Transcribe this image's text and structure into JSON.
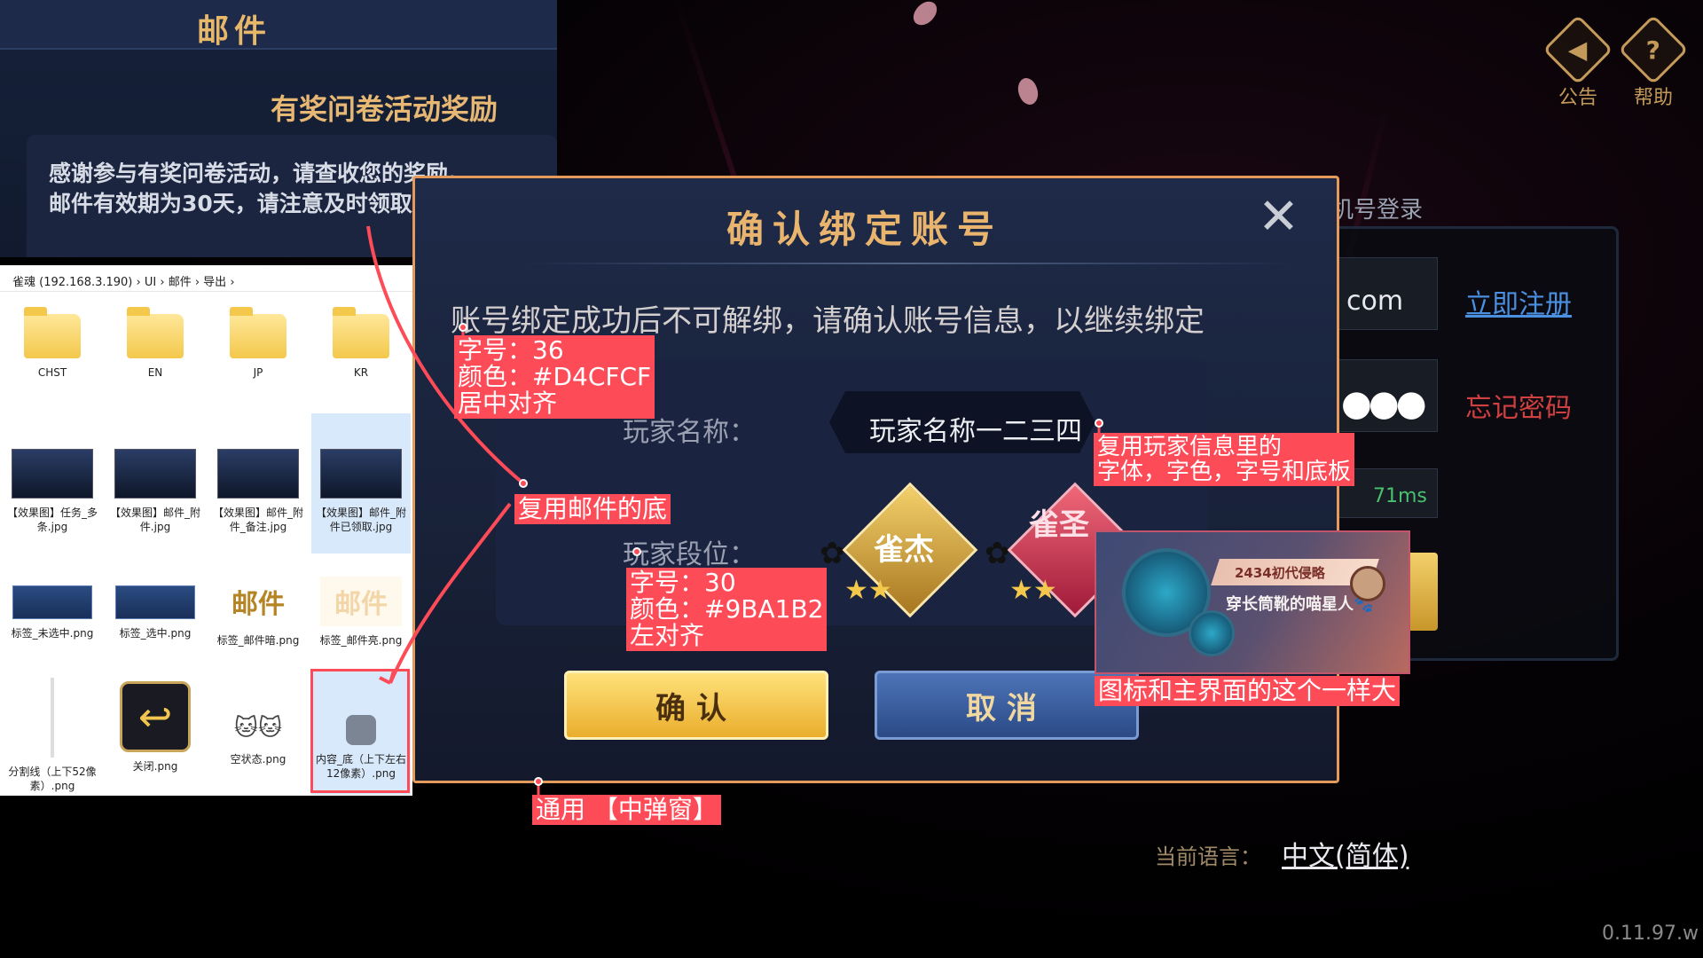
{
  "top_right": {
    "announcement_label": "公告",
    "help_label": "帮助"
  },
  "login": {
    "title_fragment": "机号登录",
    "email_fragment": "com",
    "password_dots": "●●●",
    "ping": "71ms",
    "register_link": "立即注册",
    "forgot_link": "忘记密码",
    "language_label": "当前语言：",
    "language_value": "中文(简体)"
  },
  "version": "0.11.97.w",
  "mail_panel": {
    "tab": "邮件",
    "subject": "有奖问卷活动奖励",
    "body_line1": "感谢参与有奖问卷活动，请查收您的奖励。",
    "body_line2": "邮件有效期为30天，请注意及时领取。"
  },
  "explorer": {
    "breadcrumb": [
      "雀魂 (192.168.3.190)",
      "UI",
      "邮件",
      "导出"
    ],
    "files": [
      {
        "name": "CHST",
        "kind": "folder"
      },
      {
        "name": "EN",
        "kind": "folder"
      },
      {
        "name": "JP",
        "kind": "folder"
      },
      {
        "name": "KR",
        "kind": "folder"
      },
      {
        "name": "【效果图】任务_多条.jpg",
        "kind": "thumb"
      },
      {
        "name": "【效果图】邮件_附件.jpg",
        "kind": "thumb"
      },
      {
        "name": "【效果图】邮件_附件_备注.jpg",
        "kind": "thumb"
      },
      {
        "name": "【效果图】邮件_附件已领取.jpg",
        "kind": "thumb"
      },
      {
        "name": "标签_未选中.png",
        "kind": "bar"
      },
      {
        "name": "标签_选中.png",
        "kind": "bar"
      },
      {
        "name": "标签_邮件暗.png",
        "kind": "gold"
      },
      {
        "name": "标签_邮件亮.png",
        "kind": "gold-pale"
      },
      {
        "name": "分割线（上下52像素）.png",
        "kind": "line"
      },
      {
        "name": "关闭.png",
        "kind": "close"
      },
      {
        "name": "空状态.png",
        "kind": "cats"
      },
      {
        "name": "内容_底（上下左右12像素）.png",
        "kind": "rr"
      }
    ],
    "gold_glyph": "邮件",
    "close_glyph": "↩",
    "cats_glyph": "🐱🐱"
  },
  "dialog": {
    "title": "确认绑定账号",
    "close_glyph": "✕",
    "description": "账号绑定成功后不可解绑，请确认账号信息，以继续绑定",
    "player_name_label": "玩家名称：",
    "player_name_value": "玩家名称一二三四",
    "player_rank_label": "玩家段位：",
    "rank1_text": "雀杰",
    "rank2_text": "雀圣",
    "confirm_button": "确认",
    "cancel_button": "取消"
  },
  "profile_card": {
    "banner": "2434初代侵略",
    "name": "穿长筒靴的喵星人🐾"
  },
  "annotations": {
    "desc_style_lines": [
      "字号：36",
      "颜色：#D4CFCF",
      "居中对齐"
    ],
    "reuse_mail_bg": "复用邮件的底",
    "reuse_player_info_lines": [
      "复用玩家信息里的",
      "字体，字色，字号和底板"
    ],
    "label_style_lines": [
      "字号：30",
      "颜色：#9BA1B2",
      "左对齐"
    ],
    "icon_size_note": "图标和主界面的这个一样大",
    "generic_popup": "通用  【中弹窗】"
  },
  "colors": {
    "annotation_red": "#fd4b58",
    "description_text": "#D4CFCF",
    "label_text": "#9BA1B2",
    "dialog_border": "#e39a5a",
    "title_gold": "#e9b56e"
  }
}
